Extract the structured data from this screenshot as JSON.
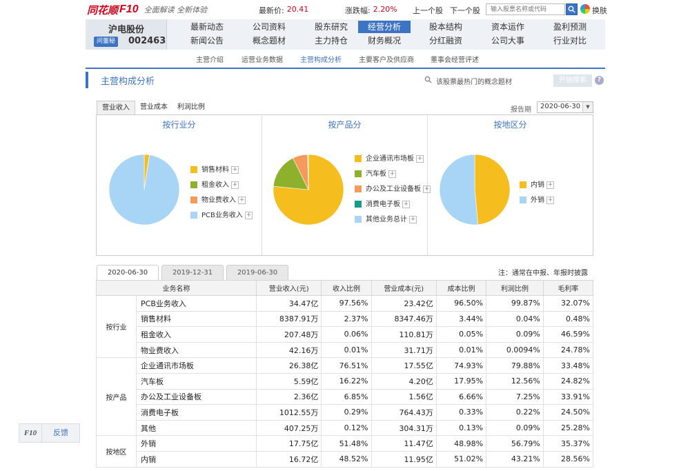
{
  "brand": {
    "name": "同花顺",
    "product": "F10",
    "slogan": "全面解读 全新体验"
  },
  "quote": {
    "latest_label": "最新价:",
    "latest_value": "20.41",
    "change_label": "涨跌幅:",
    "change_value": "2.20%"
  },
  "nav_links": {
    "prev": "上一个股",
    "next": "下一个股",
    "skin": "换肤"
  },
  "search": {
    "placeholder": "输入股票名称或代码"
  },
  "stock": {
    "name": "沪电股份",
    "ask_badge": "问董秘",
    "code": "002463"
  },
  "main_nav": [
    {
      "label": "最新动态"
    },
    {
      "label": "公司资料"
    },
    {
      "label": "股东研究"
    },
    {
      "label": "经营分析"
    },
    {
      "label": "股本结构"
    },
    {
      "label": "资本运作"
    },
    {
      "label": "盈利预测"
    },
    {
      "label": "新闻公告"
    },
    {
      "label": "概念题材"
    },
    {
      "label": "主力持仓"
    },
    {
      "label": "财务概况"
    },
    {
      "label": "分红融资"
    },
    {
      "label": "公司大事"
    },
    {
      "label": "行业对比"
    }
  ],
  "sub_nav": [
    {
      "label": "主营介绍"
    },
    {
      "label": "运营业务数据"
    },
    {
      "label": "主营构成分析"
    },
    {
      "label": "主要客户及供应商"
    },
    {
      "label": "董事会经营评述"
    }
  ],
  "section": {
    "title": "主营构成分析",
    "concept_link": "该股票最热门的概念题材",
    "start_button": "开始搜索",
    "help": "?"
  },
  "metric_tabs": [
    {
      "label": "营业收入"
    },
    {
      "label": "营业成本"
    },
    {
      "label": "利润比例"
    }
  ],
  "report": {
    "label": "报告期",
    "selected": "2020-06-30"
  },
  "colors": {
    "accent": "#3d73c5",
    "yellow": "#f5be1e",
    "green": "#8db12d",
    "orange": "#f59a5a",
    "teal": "#1a9a8a",
    "lightblue": "#a8d4f5",
    "up": "#d0021b"
  },
  "chart_data": [
    {
      "type": "pie",
      "title": "按行业分",
      "categories": [
        "销售材料",
        "租金收入",
        "物业费收入",
        "PCB业务收入"
      ],
      "values": [
        2.37,
        0.06,
        0.01,
        97.56
      ],
      "colors": [
        "#f5be1e",
        "#8db12d",
        "#f59a5a",
        "#a8d4f5"
      ]
    },
    {
      "type": "pie",
      "title": "按产品分",
      "categories": [
        "企业通讯市场板",
        "汽车板",
        "办公及工业设备板",
        "消费电子板",
        "其他业务总计"
      ],
      "values": [
        76.51,
        16.22,
        6.85,
        0.29,
        0.12
      ],
      "colors": [
        "#f5be1e",
        "#8db12d",
        "#f59a5a",
        "#1a9a8a",
        "#a8d4f5"
      ]
    },
    {
      "type": "pie",
      "title": "按地区分",
      "categories": [
        "内销",
        "外销"
      ],
      "values": [
        48.52,
        51.48
      ],
      "colors": [
        "#f5be1e",
        "#a8d4f5"
      ]
    }
  ],
  "date_tabs": [
    {
      "label": "2020-06-30"
    },
    {
      "label": "2019-12-31"
    },
    {
      "label": "2019-06-30"
    }
  ],
  "note": "注：通常在中报、年报时披露",
  "table": {
    "headers": [
      "业务名称",
      "营业收入(元)",
      "收入比例",
      "营业成本(元)",
      "成本比例",
      "利润比例",
      "毛利率"
    ],
    "groups": [
      {
        "name": "按行业",
        "rows": [
          [
            "PCB业务收入",
            "34.47亿",
            "97.56%",
            "23.42亿",
            "96.50%",
            "99.87%",
            "32.07%"
          ],
          [
            "销售材料",
            "8387.91万",
            "2.37%",
            "8347.46万",
            "3.44%",
            "0.04%",
            "0.48%"
          ],
          [
            "租金收入",
            "207.48万",
            "0.06%",
            "110.81万",
            "0.05%",
            "0.09%",
            "46.59%"
          ],
          [
            "物业费收入",
            "42.16万",
            "0.01%",
            "31.71万",
            "0.01%",
            "0.0094%",
            "24.78%"
          ]
        ]
      },
      {
        "name": "按产品",
        "rows": [
          [
            "企业通讯市场板",
            "26.38亿",
            "76.51%",
            "17.55亿",
            "74.93%",
            "79.88%",
            "33.48%"
          ],
          [
            "汽车板",
            "5.59亿",
            "16.22%",
            "4.20亿",
            "17.95%",
            "12.56%",
            "24.82%"
          ],
          [
            "办公及工业设备板",
            "2.36亿",
            "6.85%",
            "1.56亿",
            "6.66%",
            "7.25%",
            "33.91%"
          ],
          [
            "消费电子板",
            "1012.55万",
            "0.29%",
            "764.43万",
            "0.33%",
            "0.22%",
            "24.50%"
          ],
          [
            "其他",
            "407.25万",
            "0.12%",
            "304.31万",
            "0.13%",
            "0.09%",
            "25.28%"
          ]
        ]
      },
      {
        "name": "按地区",
        "rows": [
          [
            "外销",
            "17.75亿",
            "51.48%",
            "11.47亿",
            "48.98%",
            "56.79%",
            "35.37%"
          ],
          [
            "内销",
            "16.72亿",
            "48.52%",
            "11.95亿",
            "51.02%",
            "43.21%",
            "28.56%"
          ]
        ]
      }
    ]
  },
  "feedback": {
    "logo": "F10",
    "label": "反馈"
  }
}
